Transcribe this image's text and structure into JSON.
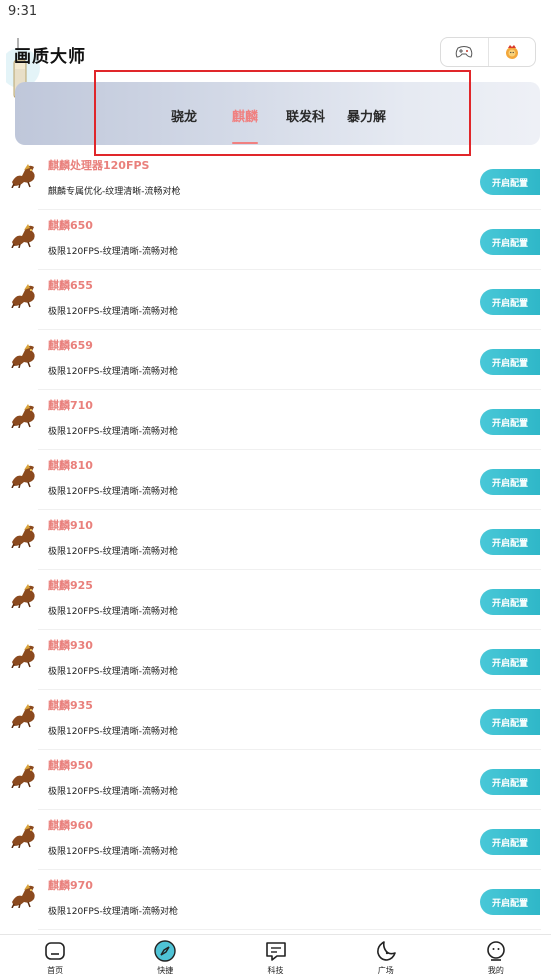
{
  "status_bar": {
    "time": "9:31"
  },
  "header": {
    "title": "画质大师",
    "icons": [
      "game-controller-icon",
      "lion-mascot-icon"
    ]
  },
  "tabs": [
    {
      "label": "骁龙",
      "active": false
    },
    {
      "label": "麒麟",
      "active": true
    },
    {
      "label": "联发科",
      "active": false
    },
    {
      "label": "暴力解",
      "active": false
    }
  ],
  "items": [
    {
      "name": "麒麟处理器120FPS",
      "desc": "麒麟专属优化-纹理清晰-流畅对枪",
      "button": "开启配置"
    },
    {
      "name": "麒麟650",
      "desc": "极限120FPS-纹理清晰-流畅对枪",
      "button": "开启配置"
    },
    {
      "name": "麒麟655",
      "desc": "极限120FPS-纹理清晰-流畅对枪",
      "button": "开启配置"
    },
    {
      "name": "麒麟659",
      "desc": "极限120FPS-纹理清晰-流畅对枪",
      "button": "开启配置"
    },
    {
      "name": "麒麟710",
      "desc": "极限120FPS-纹理清晰-流畅对枪",
      "button": "开启配置"
    },
    {
      "name": "麒麟810",
      "desc": "极限120FPS-纹理清晰-流畅对枪",
      "button": "开启配置"
    },
    {
      "name": "麒麟910",
      "desc": "极限120FPS-纹理清晰-流畅对枪",
      "button": "开启配置"
    },
    {
      "name": "麒麟925",
      "desc": "极限120FPS-纹理清晰-流畅对枪",
      "button": "开启配置"
    },
    {
      "name": "麒麟930",
      "desc": "极限120FPS-纹理清晰-流畅对枪",
      "button": "开启配置"
    },
    {
      "name": "麒麟935",
      "desc": "极限120FPS-纹理清晰-流畅对枪",
      "button": "开启配置"
    },
    {
      "name": "麒麟950",
      "desc": "极限120FPS-纹理清晰-流畅对枪",
      "button": "开启配置"
    },
    {
      "name": "麒麟960",
      "desc": "极限120FPS-纹理清晰-流畅对枪",
      "button": "开启配置"
    },
    {
      "name": "麒麟970",
      "desc": "极限120FPS-纹理清晰-流畅对枪",
      "button": "开启配置"
    }
  ],
  "bottom_nav": [
    {
      "label": "首页",
      "icon": "home-icon",
      "active": false
    },
    {
      "label": "快捷",
      "icon": "compass-icon",
      "active": true
    },
    {
      "label": "科技",
      "icon": "message-icon",
      "active": false
    },
    {
      "label": "广场",
      "icon": "moon-icon",
      "active": false
    },
    {
      "label": "我的",
      "icon": "profile-icon",
      "active": false
    }
  ],
  "colors": {
    "accent_pink": "#f08080",
    "item_name": "#e9807c",
    "button_teal": "#2fb7c8",
    "highlight_red": "#e0262a"
  }
}
